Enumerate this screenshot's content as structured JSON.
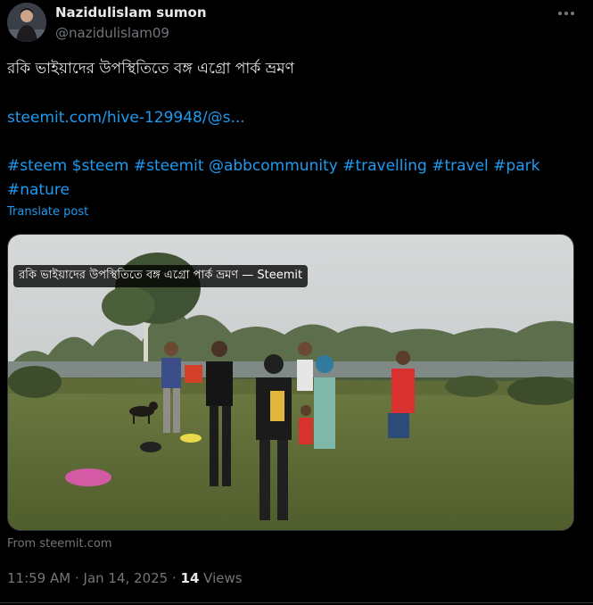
{
  "author": {
    "display_name": "Nazidulislam sumon",
    "handle": "@nazidulislam09"
  },
  "post": {
    "title_line": "রকি ভাইয়াদের উপস্থিতিতে বঙ্গ এগ্রো পার্ক ভ্রমণ",
    "link": "steemit.com/hive-129948/@s...",
    "hashtags_line1": [
      "#steem",
      "$steem",
      "#steemit",
      "@abbcommunity",
      "#travelling",
      "#travel",
      "#park"
    ],
    "hashtags_line2": [
      "#nature"
    ],
    "translate_label": "Translate post"
  },
  "link_card": {
    "caption": "রকি ভাইয়াদের উপস্থিতিতে বঙ্গ এগ্রো পার্ক ভ্রমণ — Steemit",
    "source": "From steemit.com"
  },
  "meta": {
    "time": "11:59 AM",
    "separator": " · ",
    "date": "Jan 14, 2025",
    "views_count": "14",
    "views_label": "Views"
  },
  "icons": {
    "more": "more-horizontal-icon"
  }
}
